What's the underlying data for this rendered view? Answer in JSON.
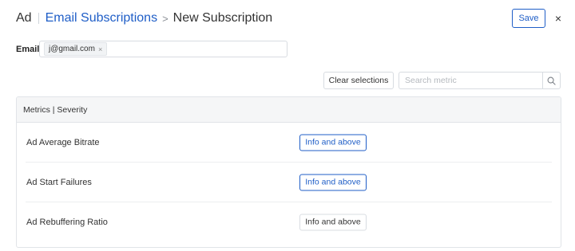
{
  "header": {
    "root": "Ad",
    "link": "Email Subscriptions",
    "arrow": ">",
    "current": "New Subscription",
    "save_label": "Save",
    "close_label": "×"
  },
  "email": {
    "label": "Email",
    "chip_value": "j@gmail.com",
    "chip_remove": "×"
  },
  "toolbar": {
    "clear_label": "Clear selections",
    "search_placeholder": "Search metric"
  },
  "table": {
    "header": "Metrics | Severity",
    "rows": [
      {
        "metric": "Ad Average Bitrate",
        "severity": "Info and above",
        "active": true
      },
      {
        "metric": "Ad Start Failures",
        "severity": "Info and above",
        "active": true
      },
      {
        "metric": "Ad Rebuffering Ratio",
        "severity": "Info and above",
        "active": false
      }
    ]
  },
  "colors": {
    "accent": "#1f5ec7",
    "border": "#d8dce1",
    "header_bg": "#f5f6f7"
  },
  "icons": {
    "search": "search-icon",
    "close": "close-icon",
    "chip_remove": "close-icon"
  }
}
